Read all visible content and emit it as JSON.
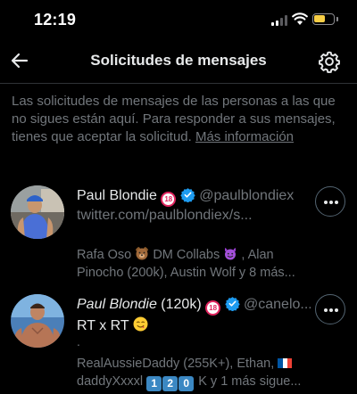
{
  "status_bar": {
    "time": "12:19",
    "battery_level": 0.45,
    "battery_color": "#f7ce46",
    "signal_bars_active": 2
  },
  "header": {
    "title": "Solicitudes de mensajes",
    "back_icon": "arrow-left-icon",
    "settings_icon": "gear-icon"
  },
  "info": {
    "text": "Las solicitudes de mensajes de las personas a las que no sigues están aquí. Para responder a sus mensajes, tienes que aceptar la solicitud.",
    "link": "Más información"
  },
  "requests": [
    {
      "name": "Paul Blondie",
      "badge_18": "18",
      "handle": "@paulblondiex",
      "preview": "twitter.com/paulblondiex/s...",
      "followed_by_a": "Rafa Oso",
      "followed_by_b": "DM Collabs",
      "followed_by_c": ", Alan",
      "followed_by_line2": "Pinocho (200k), Austin Wolf y 8 más...",
      "more_icon": "more-horizontal-icon"
    },
    {
      "name": "Paul Blondie",
      "name_suffix": " (120k)",
      "badge_18": "18",
      "handle": "@canelo...",
      "preview": "RT x RT",
      "dot": ".",
      "followed_by_a": "RealAussieDaddy (255K+), Ethan,",
      "followed_by_line2_a": "daddyXxxxl",
      "keys": [
        "1",
        "2",
        "0"
      ],
      "followed_by_line2_b": "K y 1 más sigue...",
      "more_icon": "more-horizontal-icon"
    }
  ],
  "colors": {
    "background": "#000000",
    "text_primary": "#e7e9ea",
    "text_secondary": "#71767b",
    "verified_blue": "#1d9bf0",
    "divider": "#2f3336"
  }
}
